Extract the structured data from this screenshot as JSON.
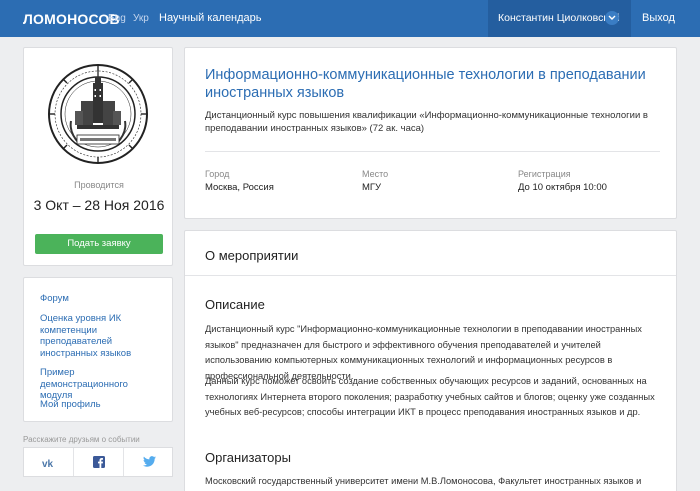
{
  "header": {
    "brand": "ЛОМОНОСОВ",
    "lang_eng": "Eng",
    "lang_ukr": "Укр",
    "nav_calendar": "Научный календарь",
    "user_name": "Константин Циолковский",
    "logout": "Выход"
  },
  "left": {
    "held_label": "Проводится",
    "dates": "3 Окт – 28 Ноя 2016",
    "apply_button": "Подать заявку",
    "links": [
      "Форум",
      "Оценка уровня ИК компетенции преподавателей иностранных языков",
      "Пример демонстрационного модуля",
      "Мой профиль"
    ],
    "share_label": "Расскажите друзьям о событии",
    "share_icons": [
      "vk-icon",
      "facebook-icon",
      "twitter-icon"
    ]
  },
  "event": {
    "title": "Информационно-коммуникационные технологии в преподавании иностранных языков",
    "subtitle": "Дистанционный курс повышения квалификации «Информационно-коммуникационные технологии в преподавании иностранных языков» (72 ак. часа)",
    "city_label": "Город",
    "city_value": "Москва, Россия",
    "place_label": "Место",
    "place_value": "МГУ",
    "reg_label": "Регистрация",
    "reg_value": "До 10 октября 10:00"
  },
  "about": {
    "heading": "О мероприятии",
    "description_heading": "Описание",
    "description_p1": "Дистанционный курс \"Информационно-коммуникационные технологии в преподавании иностранных языков\" предназначен для быстрого и эффективного обучения преподавателей и учителей использованию компьютерных коммуникационных технологий и информационных ресурсов в профессиональной деятельности.",
    "description_p2": "Данный курс поможет освоить создание собственных обучающих ресурсов и заданий, основанных на технологиях Интернета второго поколения; разработку учебных сайтов и блогов; оценку уже созданных учебных веб-ресурсов; способы интеграции ИКТ в процесс преподавания иностранных языков и др.",
    "organizers_heading": "Организаторы",
    "organizers_text": "Московский государственный университет имени М.В.Ломоносова, Факультет иностранных языков и"
  },
  "colors": {
    "header_bg": "#2c6db3",
    "accent_link": "#2c6db3",
    "apply_green": "#4bb35a"
  }
}
